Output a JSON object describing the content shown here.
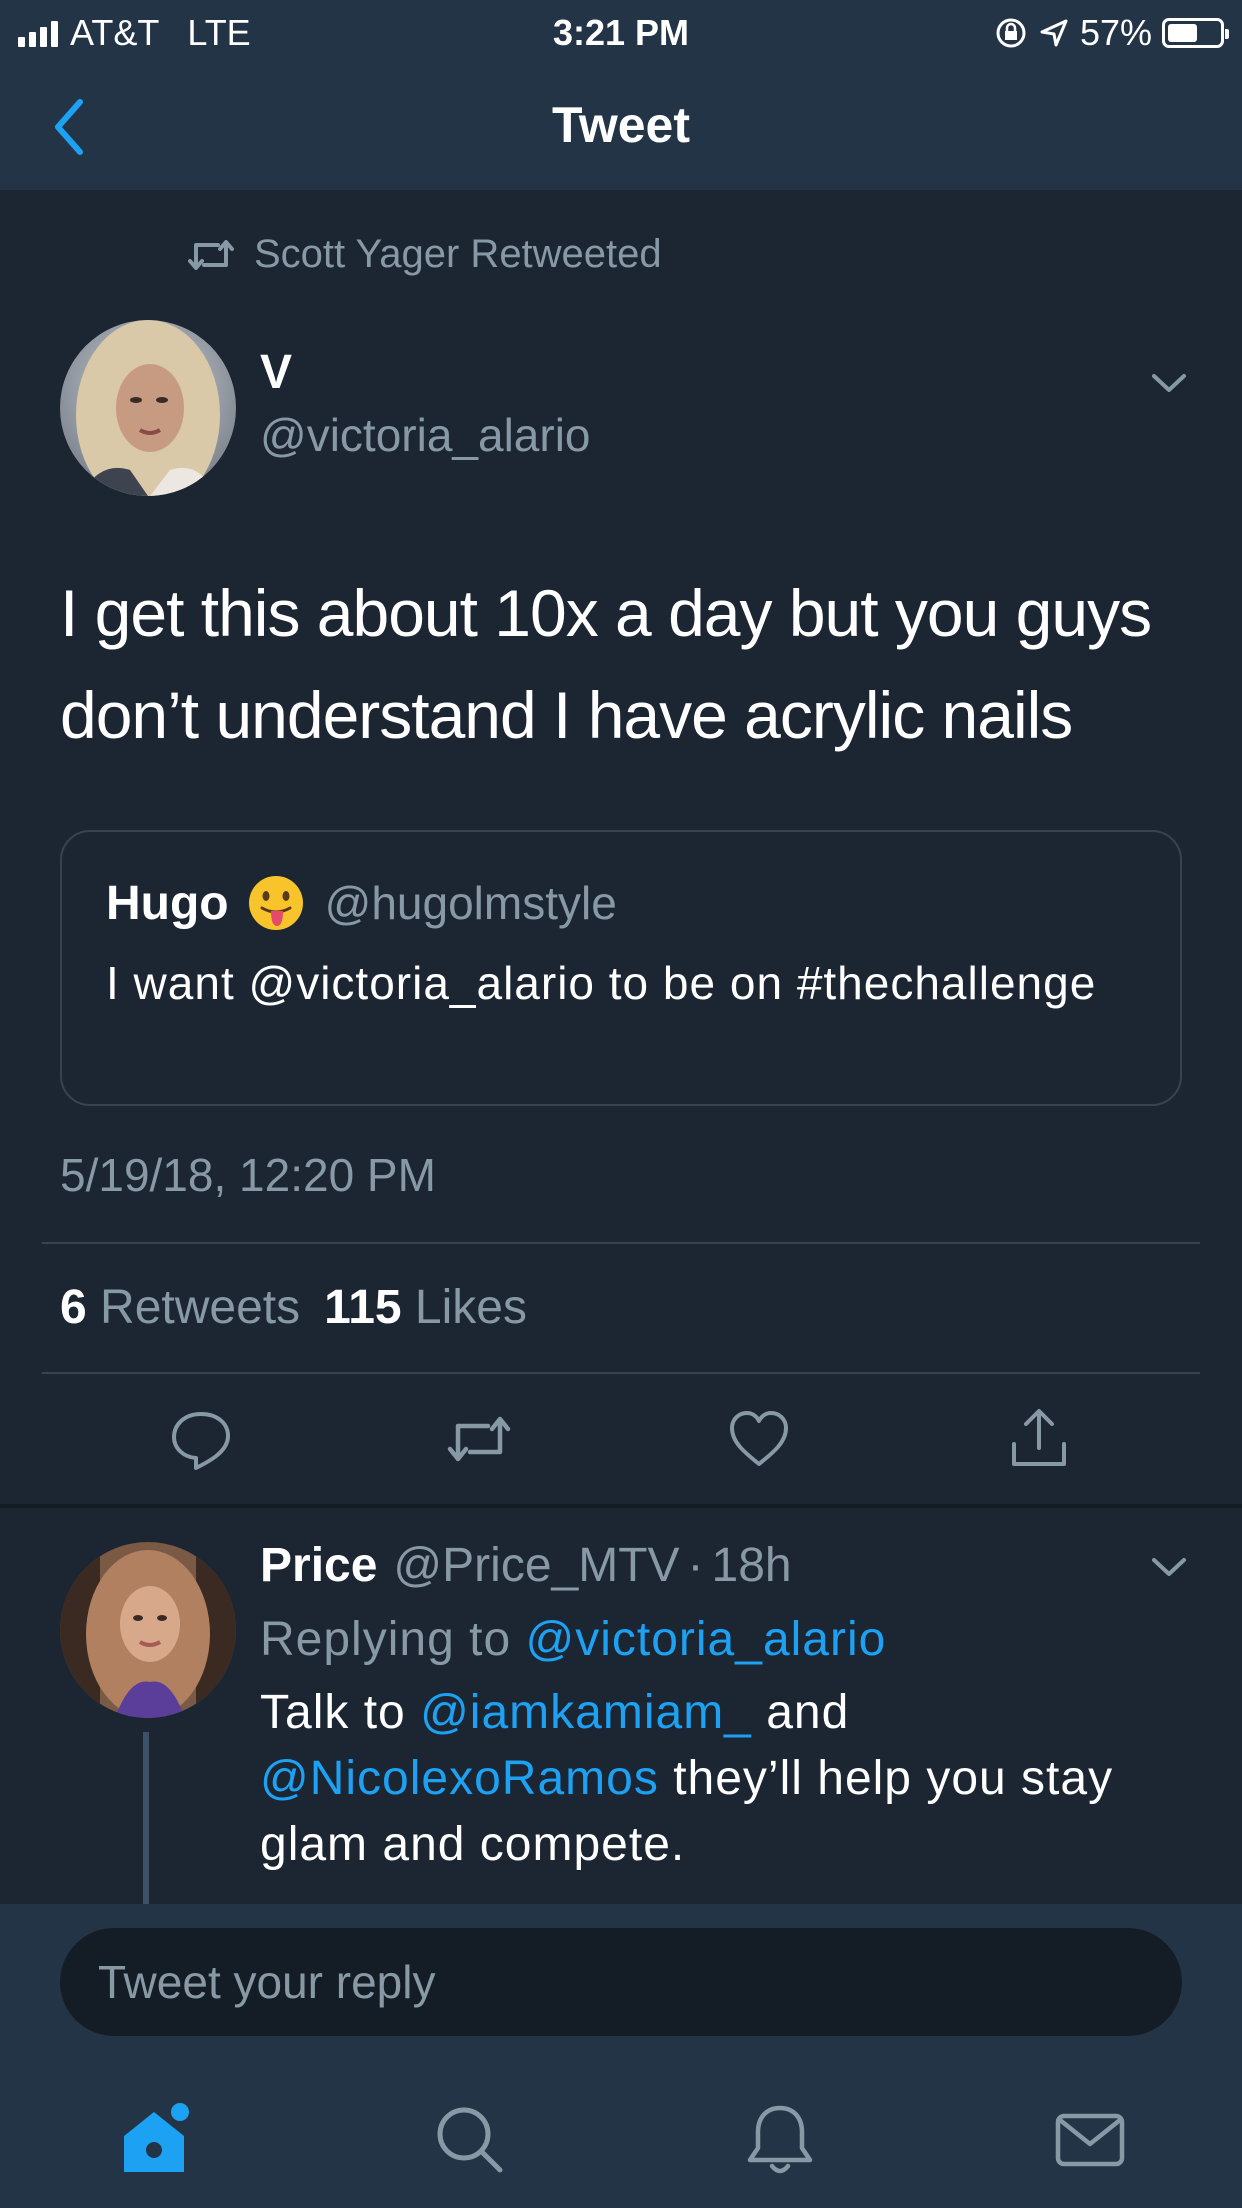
{
  "status_bar": {
    "carrier": "AT&T",
    "network": "LTE",
    "time": "3:21 PM",
    "battery": "57%",
    "battery_level": 0.57
  },
  "header": {
    "title": "Tweet",
    "back_icon": "chevron-left-icon"
  },
  "tweet": {
    "retweeted_by": "Scott Yager Retweeted",
    "author_name": "V",
    "author_handle": "@victoria_alario",
    "text": "I get this about 10x a day but you guys don’t understand I have acrylic nails",
    "quote": {
      "name": "Hugo",
      "emoji": "tongue-out-face-emoji",
      "handle": "@hugolmstyle",
      "text": "I want @victoria_alario to be on #thechallenge"
    },
    "timestamp": "5/19/18, 12:20 PM",
    "retweet_count": "6",
    "retweet_label": "Retweets",
    "like_count": "115",
    "like_label": "Likes",
    "actions": [
      "reply-icon",
      "retweet-icon",
      "like-icon",
      "share-icon"
    ]
  },
  "reply": {
    "name": "Price",
    "handle": "@Price_MTV",
    "separator": "·",
    "time": "18h",
    "replying_prefix": "Replying to",
    "replying_to": "@victoria_alario",
    "text_part1": "Talk to",
    "mention1": "@iamkamiam_",
    "text_part2": "and",
    "mention2": "@NicolexoRamos",
    "text_part3": "they’ll help you stay glam and compete."
  },
  "composer": {
    "placeholder": "Tweet your reply"
  },
  "tab_bar": {
    "tabs": [
      "home-icon",
      "search-icon",
      "notifications-icon",
      "messages-icon"
    ],
    "active": "home-icon"
  },
  "colors": {
    "background": "#1c2532",
    "header": "#243447",
    "accent": "#1da1f2",
    "muted": "#8899a6",
    "border": "#38444d"
  }
}
